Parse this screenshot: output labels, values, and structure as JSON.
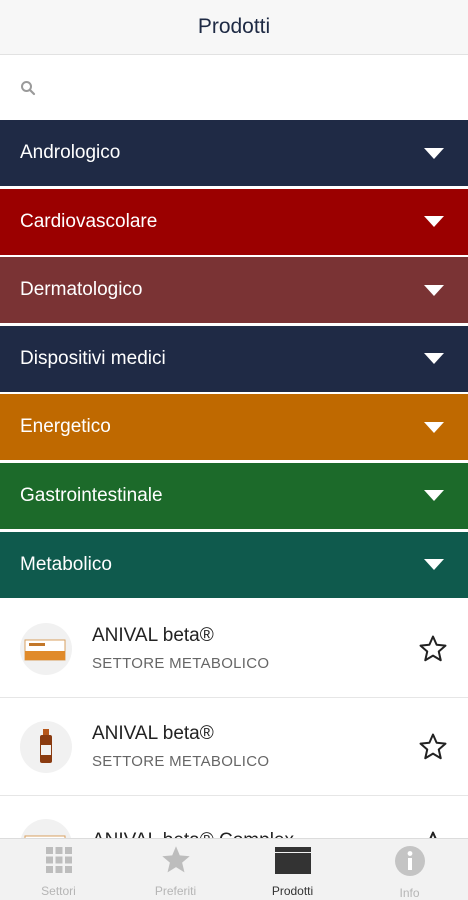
{
  "header": {
    "title": "Prodotti"
  },
  "search": {
    "placeholder": "",
    "value": "",
    "icon": "search-icon"
  },
  "categories": [
    {
      "label": "Andrologico",
      "color": "#1f2a45"
    },
    {
      "label": "Cardiovascolare",
      "color": "#9b0000"
    },
    {
      "label": "Dermatologico",
      "color": "#7a3334"
    },
    {
      "label": "Dispositivi medici",
      "color": "#1f2a45"
    },
    {
      "label": "Energetico",
      "color": "#bf6900"
    },
    {
      "label": "Gastrointestinale",
      "color": "#1c6a2a"
    },
    {
      "label": "Metabolico",
      "color": "#0f5a4d"
    }
  ],
  "products": [
    {
      "name": "ANIVAL beta®",
      "sector": "SETTORE METABOLICO",
      "thumb": "box-package"
    },
    {
      "name": "ANIVAL beta®",
      "sector": "SETTORE METABOLICO",
      "thumb": "bottle"
    },
    {
      "name": "ANIVAL beta® Complex",
      "sector": "",
      "thumb": "box-package"
    }
  ],
  "tabbar": {
    "tabs": [
      {
        "label": "Settori",
        "icon": "grid-icon",
        "active": false
      },
      {
        "label": "Preferiti",
        "icon": "star-icon",
        "active": false
      },
      {
        "label": "Prodotti",
        "icon": "folder-icon",
        "active": true
      },
      {
        "label": "Info",
        "icon": "info-icon",
        "active": false
      }
    ]
  }
}
